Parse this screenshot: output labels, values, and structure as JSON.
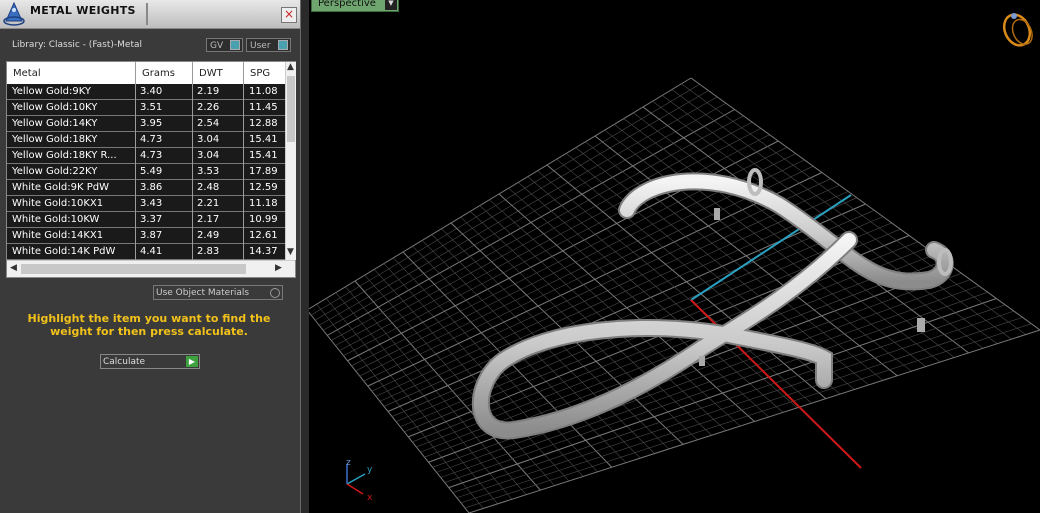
{
  "panel": {
    "title": "METAL WEIGHTS",
    "close_label": "×",
    "library_label": "Library: Classic - (Fast)-Metal",
    "toggle_gv": "GV",
    "toggle_user": "User",
    "use_object_materials": "Use Object Materials",
    "hint": "Highlight the item you want to find the weight for then press calculate.",
    "calculate_label": "Calculate",
    "calculate_arrow": "▶"
  },
  "table": {
    "columns": [
      "Metal",
      "Grams",
      "DWT",
      "SPG"
    ],
    "rows": [
      {
        "metal": "Yellow Gold:9KY",
        "grams": "3.40",
        "dwt": "2.19",
        "spg": "11.08"
      },
      {
        "metal": "Yellow Gold:10KY",
        "grams": "3.51",
        "dwt": "2.26",
        "spg": "11.45"
      },
      {
        "metal": "Yellow Gold:14KY",
        "grams": "3.95",
        "dwt": "2.54",
        "spg": "12.88"
      },
      {
        "metal": "Yellow Gold:18KY",
        "grams": "4.73",
        "dwt": "3.04",
        "spg": "15.41"
      },
      {
        "metal": "Yellow Gold:18KY R...",
        "grams": "4.73",
        "dwt": "3.04",
        "spg": "15.41"
      },
      {
        "metal": "Yellow Gold:22KY",
        "grams": "5.49",
        "dwt": "3.53",
        "spg": "17.89"
      },
      {
        "metal": "White Gold:9K PdW",
        "grams": "3.86",
        "dwt": "2.48",
        "spg": "12.59"
      },
      {
        "metal": "White Gold:10KX1",
        "grams": "3.43",
        "dwt": "2.21",
        "spg": "11.18"
      },
      {
        "metal": "White Gold:10KW",
        "grams": "3.37",
        "dwt": "2.17",
        "spg": "10.99"
      },
      {
        "metal": "White Gold:14KX1",
        "grams": "3.87",
        "dwt": "2.49",
        "spg": "12.61"
      },
      {
        "metal": "White Gold:14K PdW",
        "grams": "4.41",
        "dwt": "2.83",
        "spg": "14.37"
      }
    ]
  },
  "viewport": {
    "view_label": "Perspective",
    "view_dropdown": "▼",
    "axis_z": "z",
    "axis_y": "y",
    "axis_x": "x"
  },
  "colors": {
    "hint": "#f2c21a",
    "go_button": "#3da23d",
    "view_tab": "#6fa56f",
    "axis_x": "#d01818",
    "axis_y": "#2aa0c0"
  }
}
